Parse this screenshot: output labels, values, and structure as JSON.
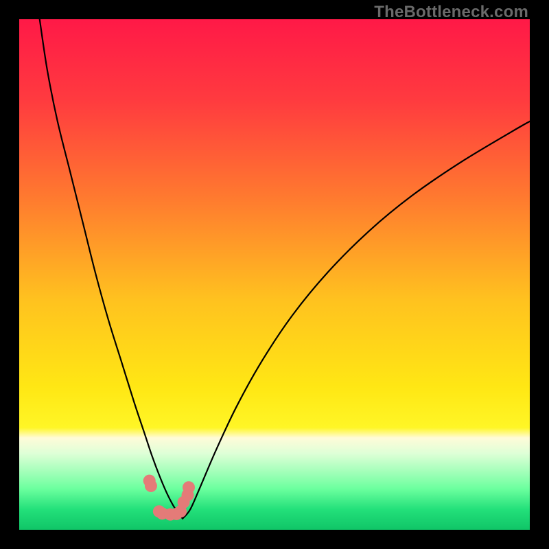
{
  "watermark": {
    "text": "TheBottleneck.com"
  },
  "chart_data": {
    "type": "line",
    "title": "",
    "xlabel": "",
    "ylabel": "",
    "xlim": [
      0,
      100
    ],
    "ylim": [
      0,
      100
    ],
    "grid": false,
    "legend": false,
    "background_gradient_stops": [
      {
        "offset": 0.0,
        "color": "#ff1947"
      },
      {
        "offset": 0.16,
        "color": "#ff3b3f"
      },
      {
        "offset": 0.35,
        "color": "#ff7a2f"
      },
      {
        "offset": 0.55,
        "color": "#ffc21f"
      },
      {
        "offset": 0.72,
        "color": "#ffe714"
      },
      {
        "offset": 0.8,
        "color": "#fff626"
      },
      {
        "offset": 0.82,
        "color": "#fffbd8"
      },
      {
        "offset": 0.85,
        "color": "#dfffd7"
      },
      {
        "offset": 0.92,
        "color": "#6bff9e"
      },
      {
        "offset": 0.96,
        "color": "#23e07a"
      },
      {
        "offset": 1.0,
        "color": "#10c567"
      }
    ],
    "series": [
      {
        "name": "left-branch",
        "type": "line",
        "x": [
          4.0,
          5.5,
          7.5,
          10.0,
          12.5,
          15.0,
          17.5,
          20.0,
          22.5,
          24.5,
          26.0,
          27.5,
          29.0,
          30.5,
          32.0
        ],
        "y": [
          100.0,
          90.0,
          80.0,
          70.0,
          60.0,
          50.0,
          41.0,
          33.0,
          25.0,
          19.0,
          14.5,
          10.5,
          7.0,
          4.2,
          2.2
        ]
      },
      {
        "name": "right-branch",
        "type": "line",
        "x": [
          32.0,
          33.5,
          35.5,
          38.5,
          42.5,
          47.5,
          53.5,
          60.5,
          68.5,
          77.0,
          86.5,
          96.5,
          100.0
        ],
        "y": [
          2.2,
          4.0,
          8.5,
          15.5,
          24.0,
          33.0,
          42.0,
          50.5,
          58.5,
          65.5,
          72.0,
          78.0,
          80.0
        ]
      },
      {
        "name": "trough-markers",
        "type": "scatter",
        "x": [
          25.5,
          25.8,
          27.4,
          28.0,
          29.6,
          30.8,
          31.6,
          33.2,
          33.0,
          32.2
        ],
        "y": [
          9.6,
          8.6,
          3.6,
          3.2,
          3.0,
          3.1,
          3.6,
          8.3,
          6.8,
          5.4
        ]
      }
    ]
  }
}
